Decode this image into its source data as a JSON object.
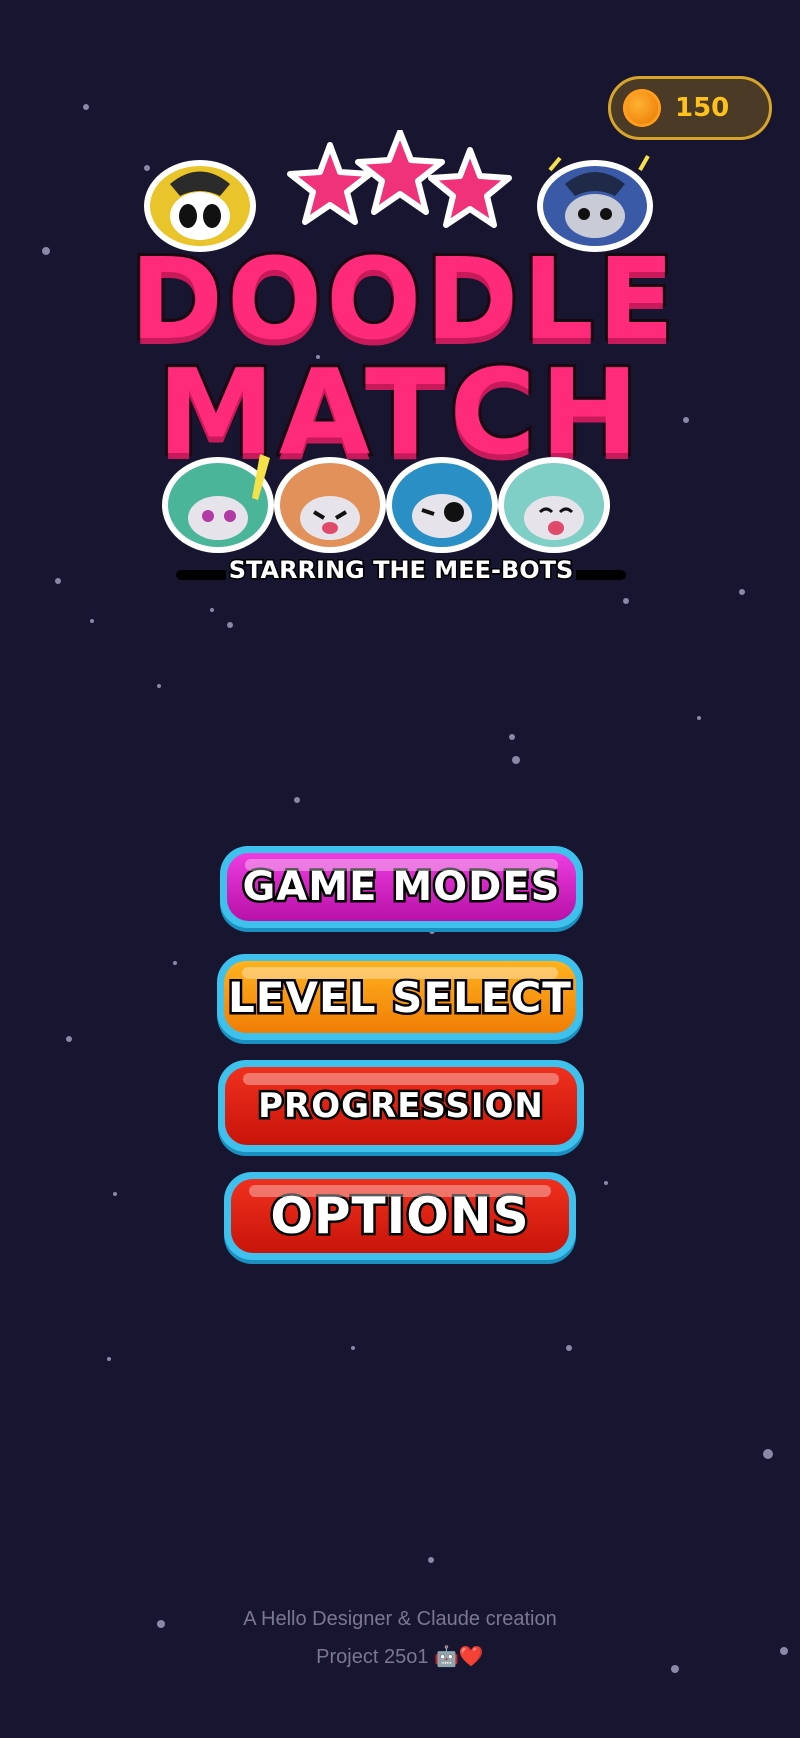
{
  "coins": {
    "icon": "coin-icon",
    "value": "150"
  },
  "logo": {
    "title_line1": "DOODLE",
    "title_line2": "MATCH",
    "tagline": "STARRING THE MEE-BOTS",
    "colors": {
      "title": "#ff2a7a",
      "stars": "#f0327a"
    }
  },
  "menu": {
    "game_modes": "GAME MODES",
    "level_select": "LEVEL SELECT",
    "progression": "PROGRESSION",
    "options": "OPTIONS"
  },
  "footer": {
    "line1": "A Hello Designer & Claude creation",
    "line2": "Project 25o1 🤖❤️"
  },
  "colors": {
    "background": "#181530",
    "button_border": "#3ec1ec",
    "coin_text": "#ffc21a"
  }
}
